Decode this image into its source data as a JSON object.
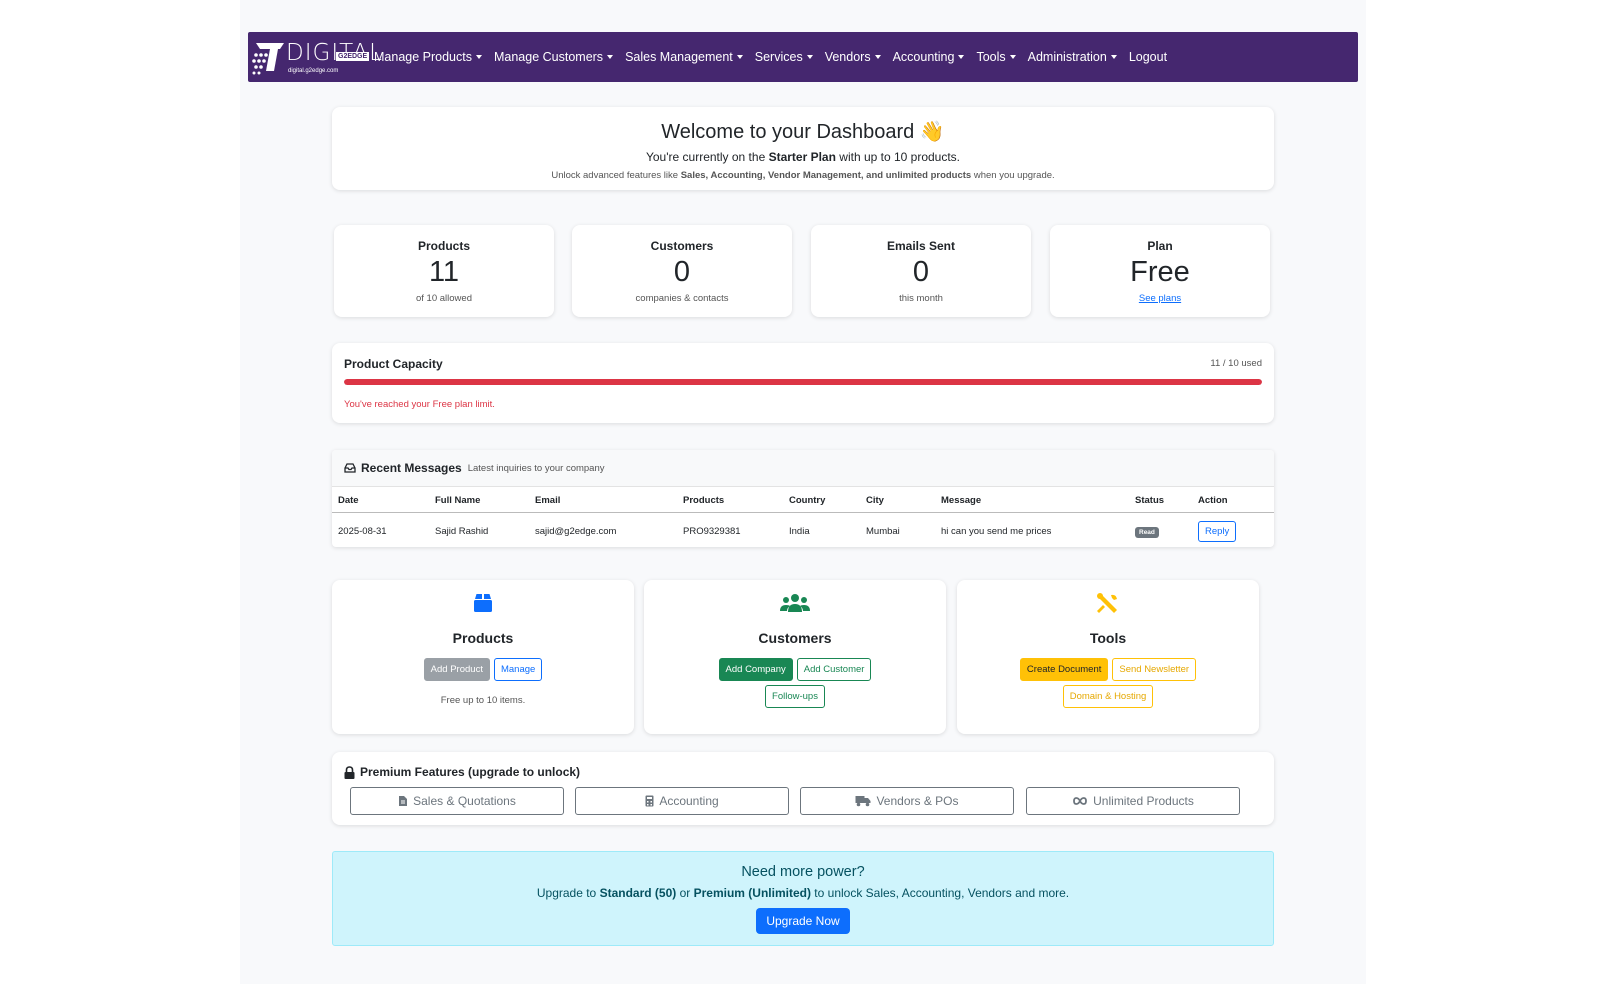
{
  "nav": {
    "logo_word": "DIGITAL",
    "logo_badge": "G2EDGE",
    "logo_url": "digital.g2edge.com",
    "items": [
      {
        "label": "Manage Products",
        "caret": true
      },
      {
        "label": "Manage Customers",
        "caret": true
      },
      {
        "label": "Sales Management",
        "caret": true
      },
      {
        "label": "Services",
        "caret": true
      },
      {
        "label": "Vendors",
        "caret": true
      },
      {
        "label": "Accounting",
        "caret": true
      },
      {
        "label": "Tools",
        "caret": true
      },
      {
        "label": "Administration",
        "caret": true
      },
      {
        "label": "Logout",
        "caret": false
      }
    ]
  },
  "welcome": {
    "title": "Welcome to your Dashboard 👋",
    "line1_pre": "You're currently on the ",
    "line1_plan": "Starter Plan",
    "line1_post": " with up to 10 products.",
    "line2_pre": "Unlock advanced features like ",
    "line2_bold": "Sales, Accounting, Vendor Management, and unlimited products",
    "line2_post": " when you upgrade."
  },
  "stats": [
    {
      "label": "Products",
      "value": "11",
      "sub": "of 10 allowed"
    },
    {
      "label": "Customers",
      "value": "0",
      "sub": "companies & contacts"
    },
    {
      "label": "Emails Sent",
      "value": "0",
      "sub": "this month"
    },
    {
      "label": "Plan",
      "value": "Free",
      "sub": "See plans"
    }
  ],
  "capacity": {
    "title": "Product Capacity",
    "used_text": "11 / 10 used",
    "fill_percent": 100,
    "warning": "You've reached your Free plan limit.",
    "bar_color": "#dc3545"
  },
  "messages": {
    "title": "Recent Messages",
    "subtitle": "Latest inquiries to your company",
    "columns": [
      "Date",
      "Full Name",
      "Email",
      "Products",
      "Country",
      "City",
      "Message",
      "Status",
      "Action"
    ],
    "rows": [
      {
        "date": "2025-08-31",
        "name": "Sajid Rashid",
        "email": "sajid@g2edge.com",
        "products": "PRO9329381",
        "country": "India",
        "city": "Mumbai",
        "message": "hi can you send me prices",
        "status": "Read",
        "action": "Reply"
      }
    ]
  },
  "features": {
    "products": {
      "title": "Products",
      "icon": "box-icon",
      "buttons": [
        "Add Product",
        "Manage"
      ],
      "note": "Free up to 10 items."
    },
    "customers": {
      "title": "Customers",
      "icon": "people-icon",
      "buttons": [
        "Add Company",
        "Add Customer",
        "Follow-ups"
      ]
    },
    "tools": {
      "title": "Tools",
      "icon": "tools-icon",
      "buttons": [
        "Create Document",
        "Send Newsletter",
        "Domain & Hosting"
      ]
    }
  },
  "premium": {
    "title": "Premium Features (upgrade to unlock)",
    "items": [
      {
        "label": "Sales & Quotations",
        "icon": "file-icon"
      },
      {
        "label": "Accounting",
        "icon": "calculator-icon"
      },
      {
        "label": "Vendors & POs",
        "icon": "truck-icon"
      },
      {
        "label": "Unlimited Products",
        "icon": "infinity-icon"
      }
    ]
  },
  "upgrade": {
    "title": "Need more power?",
    "text_pre": "Upgrade to ",
    "standard": "Standard (50)",
    "text_mid": " or ",
    "premium": "Premium (Unlimited)",
    "text_post": " to unlock Sales, Accounting, Vendors and more.",
    "button": "Upgrade Now"
  },
  "colors": {
    "nav_bg": "#45276f",
    "primary": "#0d6efd",
    "success": "#198754",
    "warning": "#ffc107",
    "danger": "#dc3545",
    "info_bg": "#cff4fc"
  }
}
